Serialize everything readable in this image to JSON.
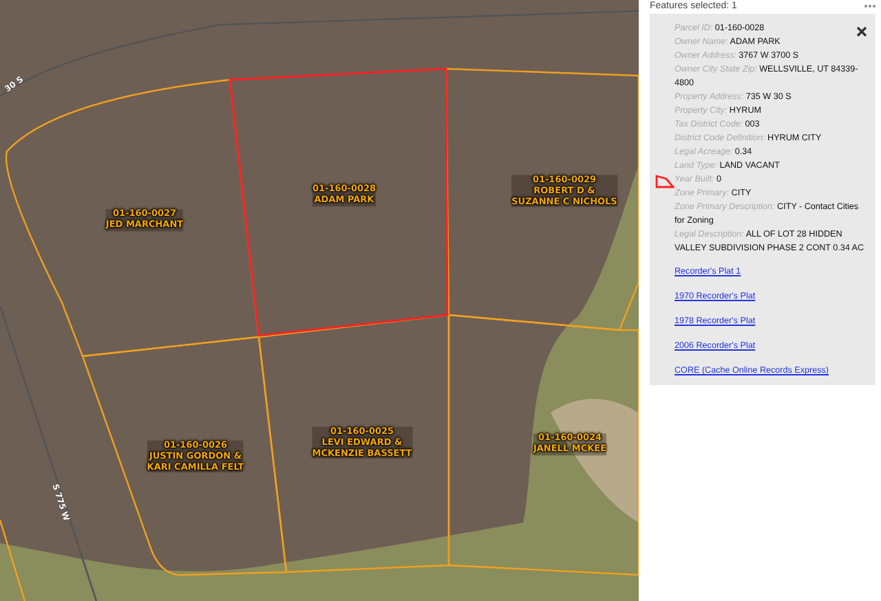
{
  "panel": {
    "header": "Features selected: 1",
    "fields": [
      {
        "label": "Parcel ID:",
        "value": "01-160-0028"
      },
      {
        "label": "Owner Name:",
        "value": "ADAM PARK"
      },
      {
        "label": "Owner Address:",
        "value": "3767 W 3700 S"
      },
      {
        "label": "Owner City State Zip:",
        "value": "WELLSVILLE, UT 84339-4800"
      },
      {
        "label": "Property Address:",
        "value": "735 W 30 S"
      },
      {
        "label": "Property City:",
        "value": "HYRUM"
      },
      {
        "label": "Tax District Code:",
        "value": "003"
      },
      {
        "label": "District Code Definition:",
        "value": "HYRUM CITY"
      },
      {
        "label": "Legal Acreage:",
        "value": "0.34"
      },
      {
        "label": "Land Type:",
        "value": "LAND VACANT"
      },
      {
        "label": "Year Built:",
        "value": "0"
      },
      {
        "label": "Zone Primary:",
        "value": "CITY"
      },
      {
        "label": "Zone Primary Description:",
        "value": "CITY - Contact Cities for Zoning"
      },
      {
        "label": "Legal Description:",
        "value": "ALL OF LOT 28 HIDDEN VALLEY SUBDIVISION PHASE 2 CONT 0.34 AC"
      }
    ],
    "links": [
      "Recorder's Plat 1",
      "1970 Recorder's Plat",
      "1978 Recorder's Plat",
      "2006 Recorder's Plat",
      "CORE (Cache Online Records Express)"
    ]
  },
  "map": {
    "roads": [
      "30 S",
      "S 775 W"
    ],
    "parcels": [
      {
        "id": "01-160-0027",
        "owner": [
          "JED MARCHANT"
        ],
        "selected": false
      },
      {
        "id": "01-160-0028",
        "owner": [
          "ADAM PARK"
        ],
        "selected": true
      },
      {
        "id": "01-160-0029",
        "owner": [
          "ROBERT D &",
          "SUZANNE C NICHOLS"
        ],
        "selected": false
      },
      {
        "id": "01-160-0026",
        "owner": [
          "JUSTIN GORDON &",
          "KARI CAMILLA FELT"
        ],
        "selected": false
      },
      {
        "id": "01-160-0025",
        "owner": [
          "LEVI EDWARD &",
          "MCKENZIE BASSETT"
        ],
        "selected": false
      },
      {
        "id": "01-160-0024",
        "owner": [
          "JANELL MCKEE"
        ],
        "selected": false
      }
    ]
  }
}
